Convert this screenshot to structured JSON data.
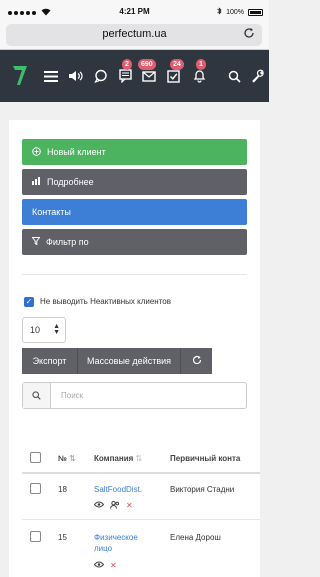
{
  "status_bar": {
    "time": "4:21 PM",
    "battery": "100%"
  },
  "browser": {
    "url": "perfectum.ua"
  },
  "nav": {
    "badges": {
      "messages": "2",
      "mail": "690",
      "tasks": "24",
      "notifications": "1"
    }
  },
  "actions": {
    "new_client": "Новый клиент",
    "details": "Подробнее",
    "contacts": "Контакты",
    "filter": "Фильтр по"
  },
  "options": {
    "hide_inactive_label": "Не выводить Неактивных клиентов",
    "page_size": "10"
  },
  "toolbar": {
    "export": "Экспорт",
    "bulk_actions": "Массовые действия"
  },
  "search": {
    "placeholder": "Поиск"
  },
  "table": {
    "headers": {
      "number": "№",
      "company": "Компания",
      "primary_contact": "Первичный конта"
    },
    "rows": [
      {
        "number": "18",
        "company": "SaltFoodDist.",
        "contact": "Виктория Стадни"
      },
      {
        "number": "15",
        "company_line1": "Физическое",
        "company_line2": "лицо",
        "contact": "Елена Дорош"
      }
    ]
  },
  "colors": {
    "nav": "#2f3640",
    "green": "#4cb35f",
    "gray": "#5f6166",
    "blue": "#3d7fd6",
    "badge": "#e05d6f",
    "delete": "#d9534f"
  }
}
